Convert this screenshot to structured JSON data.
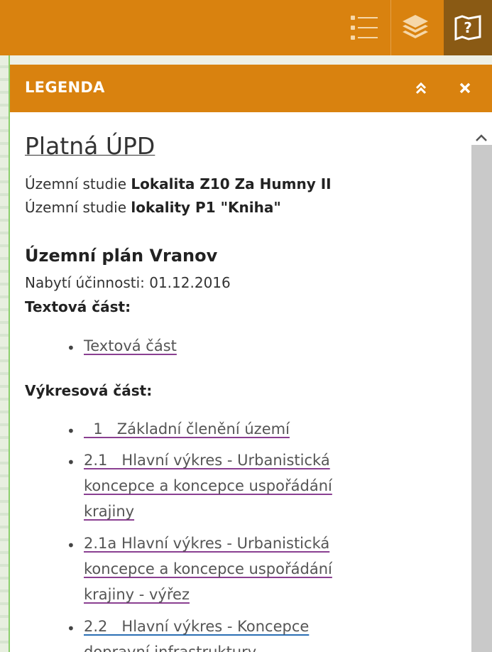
{
  "toolbar": {
    "buttons": [
      {
        "icon": "legend-list-icon"
      },
      {
        "icon": "layers-icon"
      },
      {
        "icon": "help-map-icon"
      }
    ],
    "colors": {
      "bar": "#d9820f",
      "active": "#8a5a14"
    }
  },
  "panel": {
    "title": "LEGENDA",
    "collapse_icon": "double-chevron-up-icon",
    "close_icon": "close-icon"
  },
  "legend": {
    "main_title": "Platná ÚPD",
    "studies": [
      {
        "prefix": "Územní studie ",
        "name": "Lokalita Z10 Za Humny II"
      },
      {
        "prefix": "Územní studie ",
        "name": "lokality P1 \"Kniha\""
      }
    ],
    "plan_title": "Územní plán Vranov",
    "effective": "Nabytí účinnosti: 01.12.2016",
    "text_part_heading": "Textová část:",
    "text_part_links": [
      "Textová část"
    ],
    "drawing_part_heading": "Výkresová část:",
    "drawing_links": [
      [
        "  1   Základní členění území"
      ],
      [
        "2.1   Hlavní výkres - Urbanistická",
        "koncepce a koncepce uspořádání",
        "krajiny"
      ],
      [
        "2.1a Hlavní výkres - Urbanistická",
        "koncepce a koncepce uspořádání",
        "krajiny - výřez"
      ],
      [
        "2.2   Hlavní výkres - Koncepce",
        "dopravní infrastruktury"
      ]
    ]
  }
}
